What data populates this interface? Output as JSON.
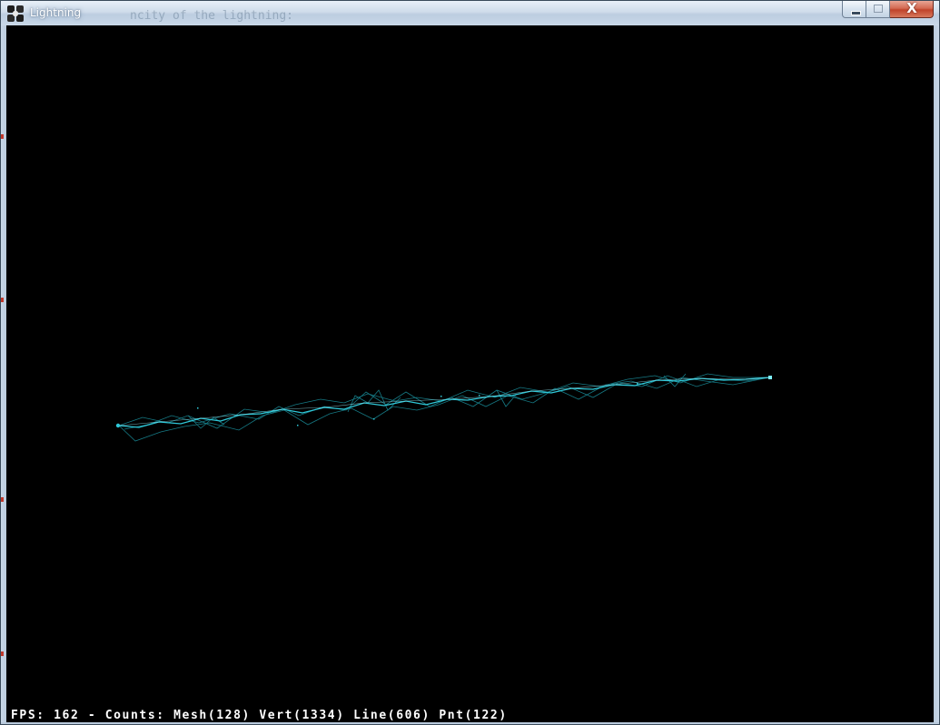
{
  "window": {
    "title": "Lightning",
    "background_title_text": "ncity of the lightning:",
    "close_glyph": "X",
    "icon": "app-logo-icon"
  },
  "scene": {
    "bolt_color": "#2fc8d8",
    "bolt_core_color": "#9ff4ff",
    "background_color": "#000000"
  },
  "status": {
    "overlay_text": "FPS: 162 - Counts: Mesh(128) Vert(1334) Line(606) Pnt(122)"
  }
}
